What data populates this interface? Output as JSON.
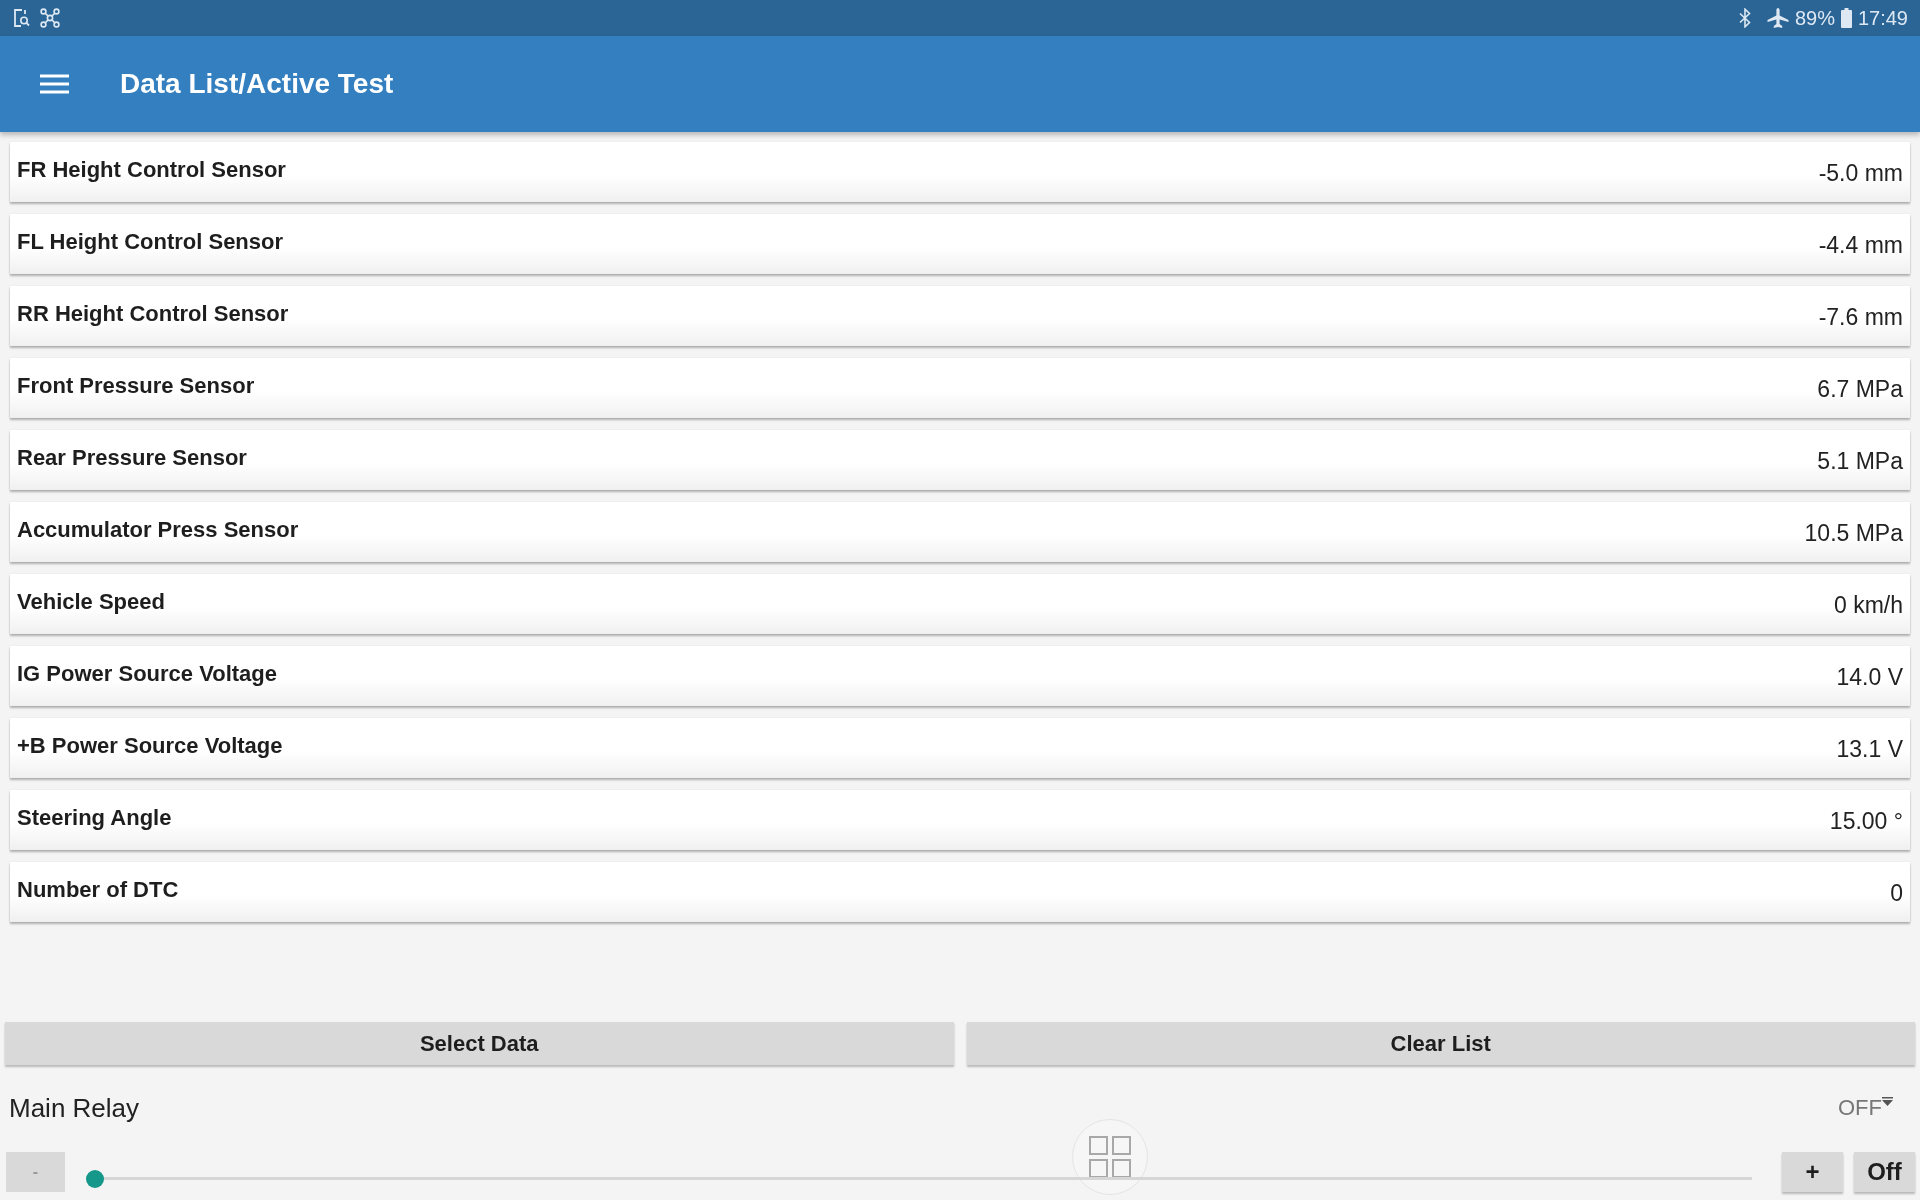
{
  "status_bar": {
    "battery": "89%",
    "time": "17:49"
  },
  "app_bar": {
    "title": "Data List/Active Test"
  },
  "data_list": [
    {
      "name": "FR Height Control Sensor",
      "value": "-5.0 mm"
    },
    {
      "name": "FL Height Control Sensor",
      "value": "-4.4 mm"
    },
    {
      "name": "RR Height Control Sensor",
      "value": "-7.6 mm"
    },
    {
      "name": "Front Pressure Sensor",
      "value": "6.7 MPa"
    },
    {
      "name": "Rear Pressure Sensor",
      "value": "5.1 MPa"
    },
    {
      "name": "Accumulator Press Sensor",
      "value": "10.5 MPa"
    },
    {
      "name": "Vehicle Speed",
      "value": "0 km/h"
    },
    {
      "name": "IG Power Source Voltage",
      "value": "14.0 V"
    },
    {
      "name": "+B Power Source Voltage",
      "value": "13.1 V"
    },
    {
      "name": "Steering Angle",
      "value": "15.00 °"
    },
    {
      "name": "Number of DTC",
      "value": "0"
    }
  ],
  "buttons": [
    {
      "label": "Select Data"
    },
    {
      "label": "Clear List"
    }
  ],
  "active_test": {
    "name": "Main Relay",
    "status": "OFF",
    "decrease": "-",
    "slider": {
      "level": 0
    },
    "increase": "+",
    "toggle": "Off"
  }
}
